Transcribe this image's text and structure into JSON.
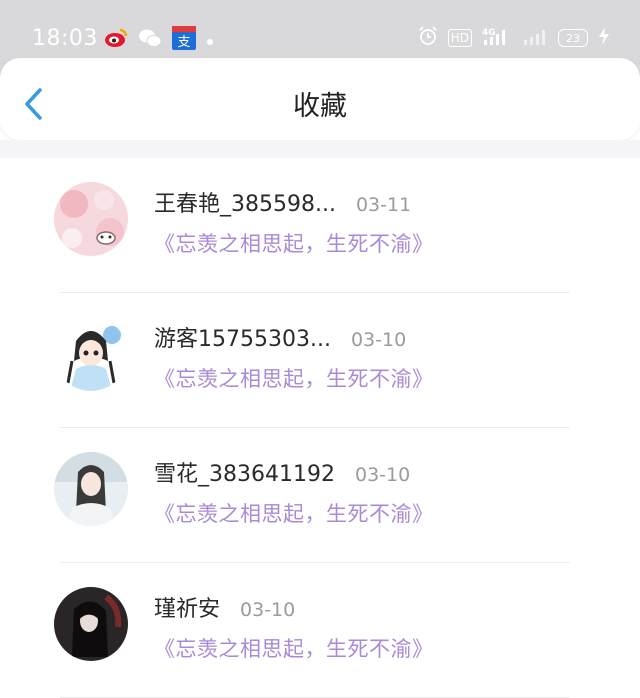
{
  "status_bar": {
    "time": "18:03",
    "left_icons": [
      "weibo-icon",
      "wechat-icon",
      "zhi-app-icon",
      "dot-icon"
    ],
    "hd_label": "HD",
    "network_label": "4G",
    "battery": "23"
  },
  "header": {
    "title": "收藏"
  },
  "favorites": [
    {
      "name": "王春艳_385598...",
      "date": "03-11",
      "message": "《忘羡之相思起，生死不渝》"
    },
    {
      "name": "游客15755303...",
      "date": "03-10",
      "message": "《忘羡之相思起，生死不渝》"
    },
    {
      "name": "雪花_383641192",
      "date": "03-10",
      "message": "《忘羡之相思起，生死不渝》"
    },
    {
      "name": "瑾祈安",
      "date": "03-10",
      "message": "《忘羡之相思起，生死不渝》"
    }
  ],
  "colors": {
    "accent": "#3a9bdc",
    "message": "#a98ad6",
    "status_bar": "#d9d9db"
  }
}
